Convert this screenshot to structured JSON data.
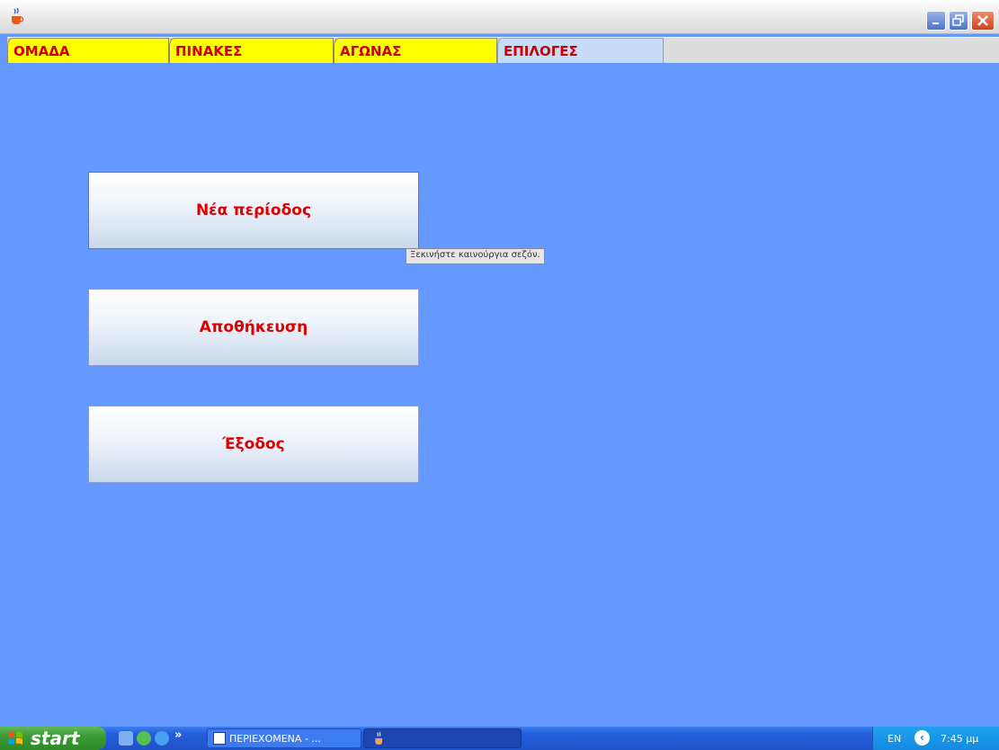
{
  "tabs": [
    {
      "label": "ΟΜΑΔΑ"
    },
    {
      "label": "ΠΙΝΑΚΕΣ"
    },
    {
      "label": "ΑΓΩΝΑΣ"
    },
    {
      "label": "ΕΠΙΛΟΓΕΣ",
      "selected": true
    }
  ],
  "buttons": {
    "new_season": "Νέα περίοδος",
    "save": "Αποθήκευση",
    "exit": "Έξοδος"
  },
  "tooltip": "Ξεκινήστε καινούργια σεζόν.",
  "taskbar": {
    "start_label": "start",
    "more": "»",
    "tasks": [
      {
        "label": "ΠΕΡΙΕΧΟΜΕΝΑ - ...",
        "icon": "word-document-icon"
      },
      {
        "label": "",
        "icon": "java-icon"
      }
    ],
    "language": "EN",
    "clock": "7:45 μμ"
  },
  "colors": {
    "background": "#6699ff",
    "tab": "#ffff00",
    "tab_selected": "#c8dcf8",
    "label_red": "#dd0000"
  }
}
